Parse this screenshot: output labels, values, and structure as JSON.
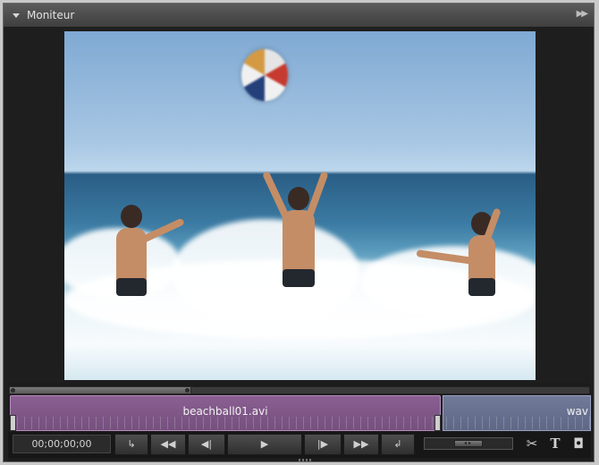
{
  "panel": {
    "title": "Moniteur"
  },
  "timeline": {
    "clips": [
      {
        "name": "beachball01.avi"
      },
      {
        "name": "wav"
      }
    ]
  },
  "controls": {
    "timecode": "00;00;00;00",
    "buttons": [
      {
        "name": "set-in-point",
        "glyph": "↳"
      },
      {
        "name": "rewind",
        "glyph": "◀◀"
      },
      {
        "name": "step-back",
        "glyph": "◀|"
      },
      {
        "name": "play",
        "glyph": "▶"
      },
      {
        "name": "step-forward",
        "glyph": "|▶"
      },
      {
        "name": "fast-forward",
        "glyph": "▶▶"
      },
      {
        "name": "set-out-point",
        "glyph": "↲"
      }
    ],
    "tools": [
      {
        "name": "scissors-icon",
        "glyph": "✂"
      },
      {
        "name": "text-icon",
        "glyph": "T"
      },
      {
        "name": "camera-icon",
        "glyph": "◘"
      }
    ]
  },
  "colors": {
    "clip_primary": "#8a5f92",
    "clip_secondary": "#727a99",
    "panel_bg": "#1f1f1f"
  }
}
